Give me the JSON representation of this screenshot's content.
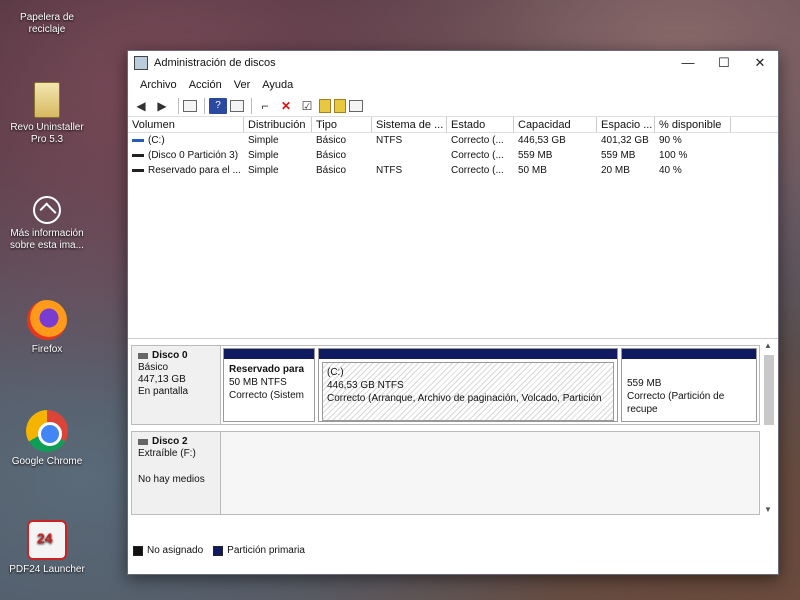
{
  "desktop": {
    "recycle_bin": "Papelera de\nreciclaje",
    "revo": "Revo Uninstaller Pro 5.3",
    "info": "Más información sobre esta ima...",
    "firefox": "Firefox",
    "chrome": "Google Chrome",
    "pdf24": "PDF24 Launcher"
  },
  "window": {
    "title": "Administración de discos",
    "minimize": "—",
    "maximize": "☐",
    "close": "✕"
  },
  "menu": [
    "Archivo",
    "Acción",
    "Ver",
    "Ayuda"
  ],
  "table": {
    "headers": [
      "Volumen",
      "Distribución",
      "Tipo",
      "Sistema de ...",
      "Estado",
      "Capacidad",
      "Espacio ...",
      "% disponible"
    ],
    "rows": [
      {
        "volume": "(C:)",
        "icon": "blue",
        "layout": "Simple",
        "type": "Básico",
        "fs": "NTFS",
        "status": "Correcto (...",
        "capacity": "446,53 GB",
        "free": "401,32 GB",
        "pct": "90 %"
      },
      {
        "volume": "(Disco 0 Partición 3)",
        "icon": "black",
        "layout": "Simple",
        "type": "Básico",
        "fs": "",
        "status": "Correcto (...",
        "capacity": "559 MB",
        "free": "559 MB",
        "pct": "100 %"
      },
      {
        "volume": "Reservado para el ...",
        "icon": "black",
        "layout": "Simple",
        "type": "Básico",
        "fs": "NTFS",
        "status": "Correcto (...",
        "capacity": "50 MB",
        "free": "20 MB",
        "pct": "40 %"
      }
    ]
  },
  "disks": {
    "disk0": {
      "name": "Disco 0",
      "type": "Básico",
      "size": "447,13 GB",
      "state": "En pantalla",
      "partitions": [
        {
          "title": "Reservado para",
          "size": "50 MB NTFS",
          "status": "Correcto (Sistem"
        },
        {
          "title": "(C:)",
          "size": "446,53 GB NTFS",
          "status": "Correcto (Arranque, Archivo de paginación, Volcado, Partición"
        },
        {
          "title": "",
          "size": "559 MB",
          "status": "Correcto (Partición de recupe"
        }
      ]
    },
    "disk2": {
      "name": "Disco 2",
      "type": "Extraíble (F:)",
      "state": "No hay medios"
    }
  },
  "legend": {
    "unallocated": "No asignado",
    "primary": "Partición primaria",
    "unallocated_color": "#111111",
    "primary_color": "#101a60"
  }
}
